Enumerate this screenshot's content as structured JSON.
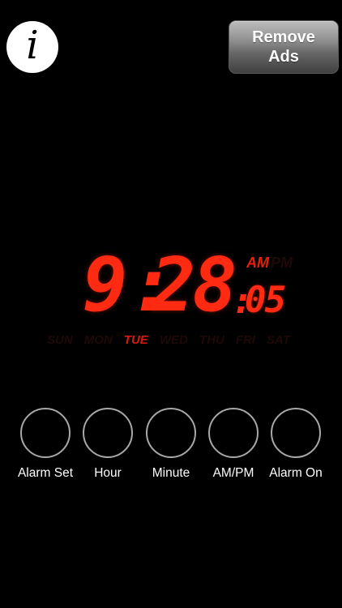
{
  "header": {
    "info_symbol": "i",
    "remove_ads_line1": "Remove",
    "remove_ads_line2": "Ads"
  },
  "clock": {
    "hours": "9",
    "minutes": "28",
    "seconds": "05",
    "colon": ":",
    "am_label": "AM",
    "pm_label": "PM",
    "active_period": "AM",
    "days": [
      "SUN",
      "MON",
      "TUE",
      "WED",
      "THU",
      "FRI",
      "SAT"
    ],
    "active_day": "TUE",
    "digit_color": "#ff2a12"
  },
  "controls": [
    {
      "label": "Alarm Set"
    },
    {
      "label": "Hour"
    },
    {
      "label": "Minute"
    },
    {
      "label": "AM/PM"
    },
    {
      "label": "Alarm On"
    }
  ]
}
